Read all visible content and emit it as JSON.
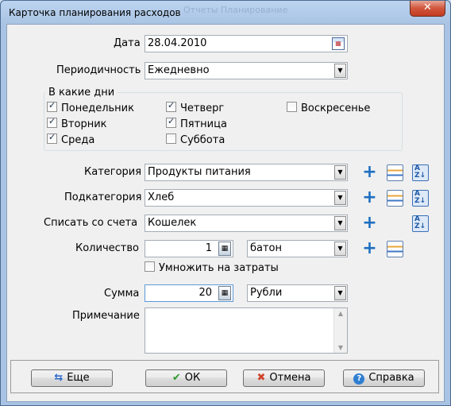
{
  "window": {
    "title": "Карточка планирования расходов",
    "close_label": "✕",
    "ghost_tabs": "Отчеты   Планирование"
  },
  "date": {
    "label": "Дата",
    "value": "28.04.2010",
    "icon": "calendar-icon"
  },
  "periodicity": {
    "label": "Периодичность",
    "value": "Ежедневно"
  },
  "days": {
    "title": "В какие дни",
    "items": [
      {
        "label": "Понедельник",
        "checked": true
      },
      {
        "label": "Вторник",
        "checked": true
      },
      {
        "label": "Среда",
        "checked": true
      },
      {
        "label": "Четверг",
        "checked": true
      },
      {
        "label": "Пятница",
        "checked": true
      },
      {
        "label": "Суббота",
        "checked": false
      },
      {
        "label": "Воскресенье",
        "checked": false
      }
    ]
  },
  "category": {
    "label": "Категория",
    "value": "Продукты питания"
  },
  "subcategory": {
    "label": "Подкатегория",
    "value": "Хлеб"
  },
  "account": {
    "label": "Списать со счета",
    "value": "Кошелек"
  },
  "quantity": {
    "label": "Количество",
    "value": "1",
    "unit": "батон"
  },
  "multiply": {
    "label": "Умножить на затраты",
    "checked": false
  },
  "sum": {
    "label": "Сумма",
    "value": "20",
    "currency": "Рубли"
  },
  "note": {
    "label": "Примечание",
    "value": ""
  },
  "buttons": {
    "more": "Еще",
    "ok": "ОК",
    "cancel": "Отмена",
    "help": "Справка"
  },
  "icons": {
    "add": "plus-icon",
    "list": "table-icon",
    "sort": "sort-az-icon",
    "calculator": "calculator-icon"
  }
}
